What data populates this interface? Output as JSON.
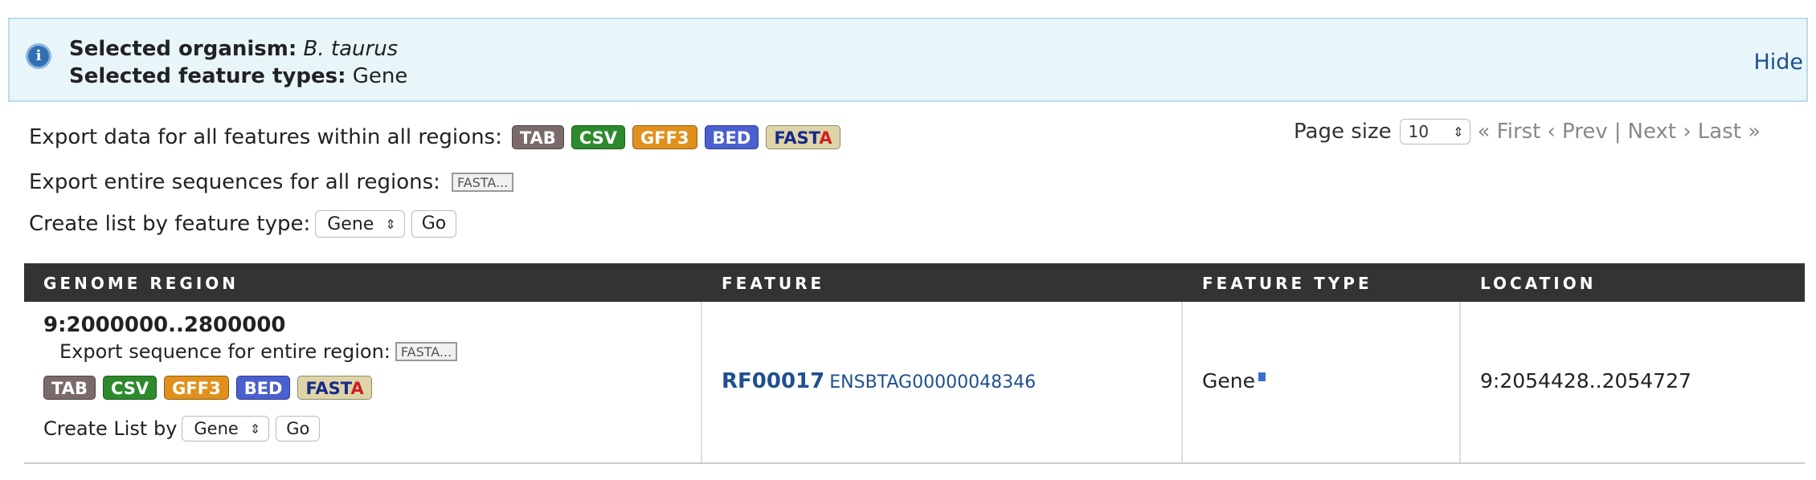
{
  "banner": {
    "organism_label": "Selected organism:",
    "organism_value": "B. taurus",
    "feature_types_label": "Selected feature types:",
    "feature_types_value": "Gene",
    "hide_label": "Hide",
    "info_icon_glyph": "i"
  },
  "export": {
    "all_features_label": "Export data for all features within all regions:",
    "sequences_label": "Export entire sequences for all regions:",
    "sequences_button": "FASTA...",
    "formats": [
      "TAB",
      "CSV",
      "GFF3",
      "BED",
      "FASTA"
    ],
    "format_colors": [
      "#7a6a6a",
      "#2c8a2c",
      "#e0901c",
      "#4a60d0",
      "#ddd5a8"
    ]
  },
  "create_list": {
    "label": "Create list by feature type:",
    "selected": "Gene",
    "go_label": "Go"
  },
  "pager": {
    "page_size_label": "Page size",
    "page_size_value": "10",
    "first": "« First",
    "prev": "‹ Prev",
    "separator": "|",
    "next": "Next ›",
    "last": "Last »"
  },
  "table": {
    "headers": [
      "GENOME REGION",
      "FEATURE",
      "FEATURE TYPE",
      "LOCATION"
    ],
    "rows": [
      {
        "region": "9:2000000..2800000",
        "export_sequence_label": "Export sequence for entire region:",
        "export_sequence_button": "FASTA...",
        "create_list_label": "Create List by",
        "create_list_selected": "Gene",
        "go_label": "Go",
        "feature_primary": "RF00017",
        "feature_secondary": "ENSBTAG00000048346",
        "feature_type": "Gene",
        "location": "9:2054428..2054727"
      }
    ]
  }
}
